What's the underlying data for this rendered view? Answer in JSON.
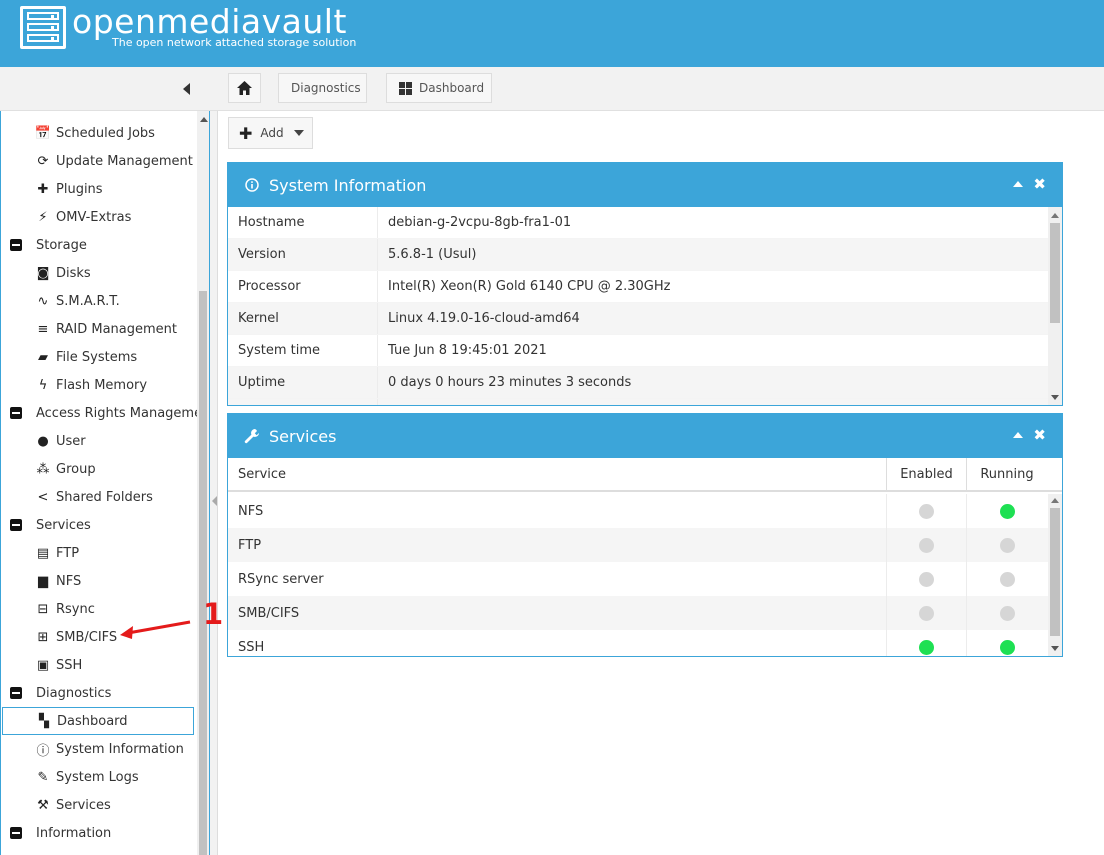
{
  "header": {
    "brand": "openmediavault",
    "tagline": "The open network attached storage solution"
  },
  "breadcrumb": {
    "home_icon": "home-icon",
    "items": [
      "Diagnostics",
      "Dashboard"
    ]
  },
  "toolbar": {
    "add_label": "Add"
  },
  "sidebar": {
    "items": [
      {
        "label": "Scheduled Jobs",
        "icon": "calendar-clock-icon",
        "level": "child"
      },
      {
        "label": "Update Management",
        "icon": "sync-icon",
        "level": "child"
      },
      {
        "label": "Plugins",
        "icon": "puzzle-icon",
        "level": "child"
      },
      {
        "label": "OMV-Extras",
        "icon": "plug-icon",
        "level": "child"
      },
      {
        "label": "Storage",
        "icon": "minus-icon",
        "level": "group"
      },
      {
        "label": "Disks",
        "icon": "disk-icon",
        "level": "child"
      },
      {
        "label": "S.M.A.R.T.",
        "icon": "pulse-icon",
        "level": "child"
      },
      {
        "label": "RAID Management",
        "icon": "database-icon",
        "level": "child"
      },
      {
        "label": "File Systems",
        "icon": "folders-icon",
        "level": "child"
      },
      {
        "label": "Flash Memory",
        "icon": "flash-icon",
        "level": "child"
      },
      {
        "label": "Access Rights Management",
        "icon": "minus-icon",
        "level": "group"
      },
      {
        "label": "User",
        "icon": "user-icon",
        "level": "child"
      },
      {
        "label": "Group",
        "icon": "group-icon",
        "level": "child"
      },
      {
        "label": "Shared Folders",
        "icon": "share-icon",
        "level": "child"
      },
      {
        "label": "Services",
        "icon": "minus-icon",
        "level": "group"
      },
      {
        "label": "FTP",
        "icon": "server-icon",
        "level": "child"
      },
      {
        "label": "NFS",
        "icon": "monitor-icon",
        "level": "child"
      },
      {
        "label": "Rsync",
        "icon": "network-icon",
        "level": "child"
      },
      {
        "label": "SMB/CIFS",
        "icon": "windows-icon",
        "level": "child"
      },
      {
        "label": "SSH",
        "icon": "terminal-icon",
        "level": "child"
      },
      {
        "label": "Diagnostics",
        "icon": "minus-icon",
        "level": "group"
      },
      {
        "label": "Dashboard",
        "icon": "dashboard-icon",
        "level": "child",
        "selected": true
      },
      {
        "label": "System Information",
        "icon": "info-icon",
        "level": "child"
      },
      {
        "label": "System Logs",
        "icon": "edit-icon",
        "level": "child"
      },
      {
        "label": "Services",
        "icon": "wrench-icon",
        "level": "child"
      },
      {
        "label": "Information",
        "icon": "minus-icon",
        "level": "group"
      }
    ]
  },
  "annotation": {
    "number": "1",
    "color": "#e41b1b"
  },
  "system_information": {
    "title": "System Information",
    "rows": [
      {
        "key": "Hostname",
        "value": "debian-g-2vcpu-8gb-fra1-01"
      },
      {
        "key": "Version",
        "value": "5.6.8-1 (Usul)"
      },
      {
        "key": "Processor",
        "value": "Intel(R) Xeon(R) Gold 6140 CPU @ 2.30GHz"
      },
      {
        "key": "Kernel",
        "value": "Linux 4.19.0-16-cloud-amd64"
      },
      {
        "key": "System time",
        "value": "Tue Jun 8 19:45:01 2021"
      },
      {
        "key": "Uptime",
        "value": "0 days 0 hours 23 minutes 3 seconds"
      }
    ]
  },
  "services": {
    "title": "Services",
    "columns": [
      "Service",
      "Enabled",
      "Running"
    ],
    "rows": [
      {
        "name": "NFS",
        "enabled": false,
        "running": true
      },
      {
        "name": "FTP",
        "enabled": false,
        "running": false
      },
      {
        "name": "RSync server",
        "enabled": false,
        "running": false
      },
      {
        "name": "SMB/CIFS",
        "enabled": false,
        "running": false
      },
      {
        "name": "SSH",
        "enabled": true,
        "running": true
      }
    ]
  },
  "colors": {
    "accent": "#3ca5d9",
    "status_on": "#1ee053",
    "status_off": "#d6d6d6"
  }
}
